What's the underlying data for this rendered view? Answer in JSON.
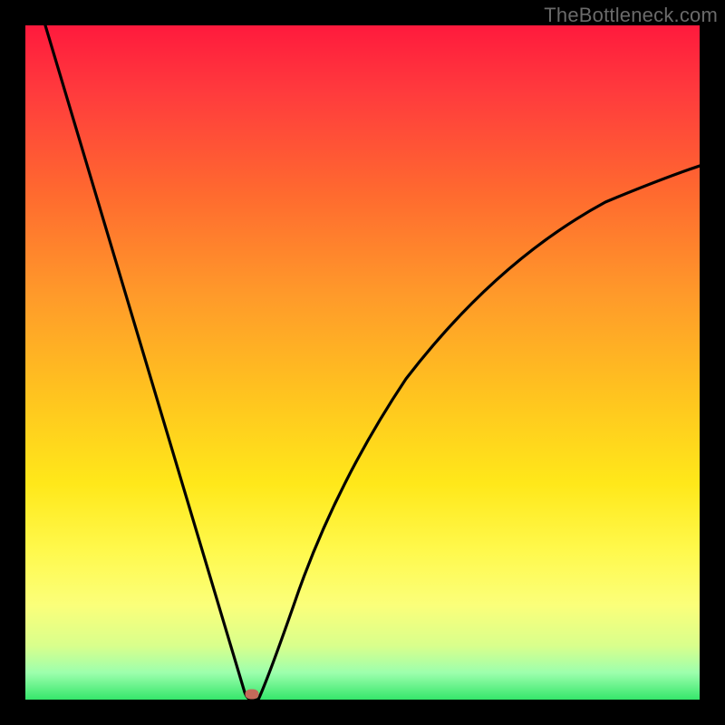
{
  "watermark": "TheBottleneck.com",
  "chart_data": {
    "type": "line",
    "title": "",
    "xlabel": "",
    "ylabel": "",
    "xlim": [
      0,
      100
    ],
    "ylim": [
      0,
      100
    ],
    "grid": false,
    "legend": false,
    "annotations": [],
    "marker": {
      "x": 33,
      "y": 1
    },
    "series": [
      {
        "name": "curve-left",
        "x": [
          3,
          6,
          9,
          12,
          15,
          18,
          21,
          24,
          27,
          30,
          31.5,
          32.5
        ],
        "y": [
          100,
          90,
          80,
          70,
          60,
          50,
          40,
          30,
          20,
          10,
          5,
          1
        ]
      },
      {
        "name": "curve-right",
        "x": [
          34,
          36,
          38,
          41,
          45,
          50,
          56,
          63,
          71,
          80,
          90,
          100
        ],
        "y": [
          1,
          7,
          15,
          25,
          35,
          45,
          54,
          62,
          68,
          73,
          77,
          80
        ]
      }
    ]
  },
  "colors": {
    "curve": "#000000",
    "frame": "#000000",
    "marker": "#c46a5a",
    "watermark": "#6a6a6a"
  }
}
